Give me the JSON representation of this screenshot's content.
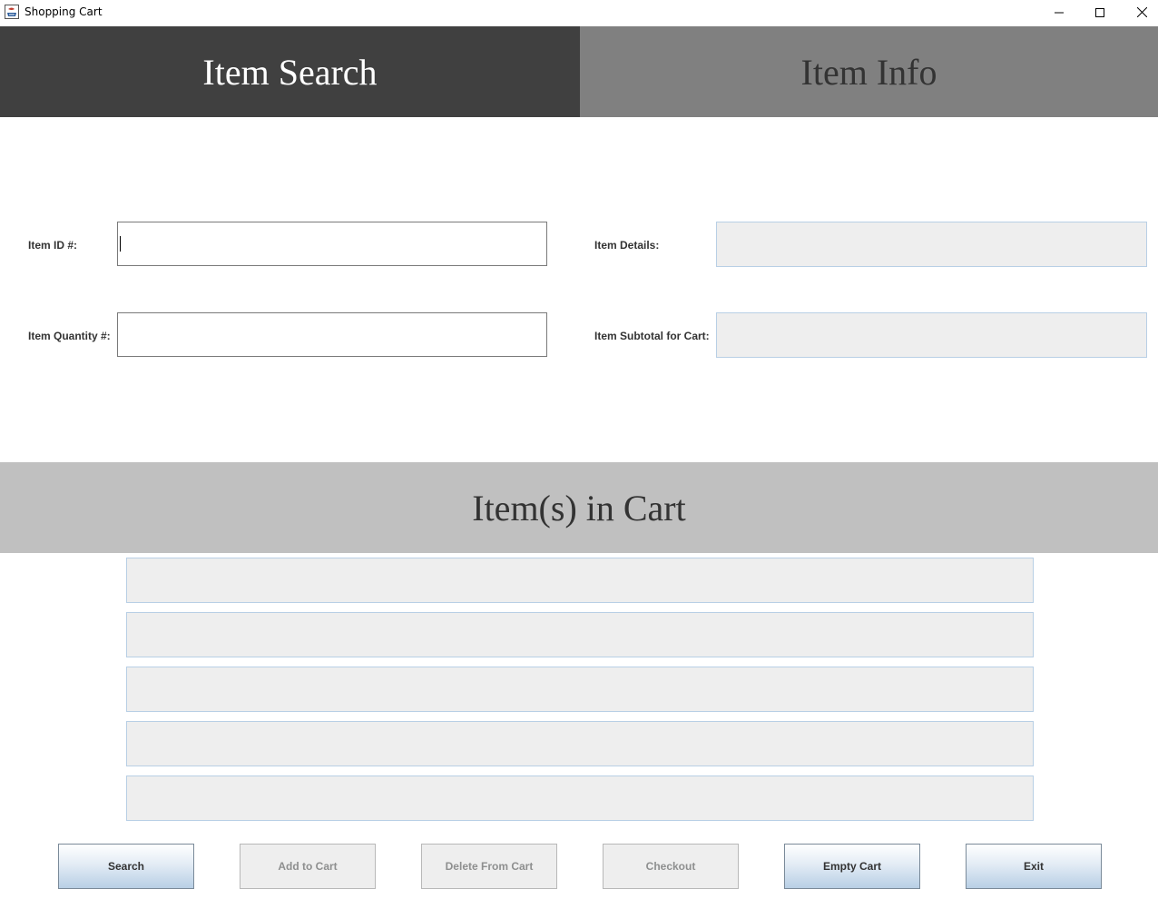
{
  "window": {
    "title": "Shopping Cart",
    "controls": [
      "minimize",
      "maximize",
      "close"
    ]
  },
  "headers": {
    "item_search": "Item Search",
    "item_info": "Item Info",
    "cart": "Item(s) in Cart"
  },
  "search_form": {
    "item_id_label": "Item ID #:",
    "item_id_value": "",
    "quantity_label": "Item Quantity #:",
    "quantity_value": ""
  },
  "info_panel": {
    "details_label": "Item Details:",
    "details_value": "",
    "subtotal_label": "Item Subtotal for Cart:",
    "subtotal_value": ""
  },
  "cart_items": [
    "",
    "",
    "",
    "",
    ""
  ],
  "buttons": {
    "search": "Search",
    "add_to_cart": "Add to Cart",
    "delete_from_cart": "Delete From Cart",
    "checkout": "Checkout",
    "empty_cart": "Empty Cart",
    "exit": "Exit"
  },
  "colors": {
    "header_left_bg": "#404040",
    "header_left_text": "#ffffff",
    "header_right_bg": "#808080",
    "header_right_text": "#333333",
    "cart_header_bg": "#c0c0c0",
    "cart_header_text": "#333333",
    "readonly_field_bg": "#eeeeee",
    "disabled_text": "#8e8f8f"
  }
}
